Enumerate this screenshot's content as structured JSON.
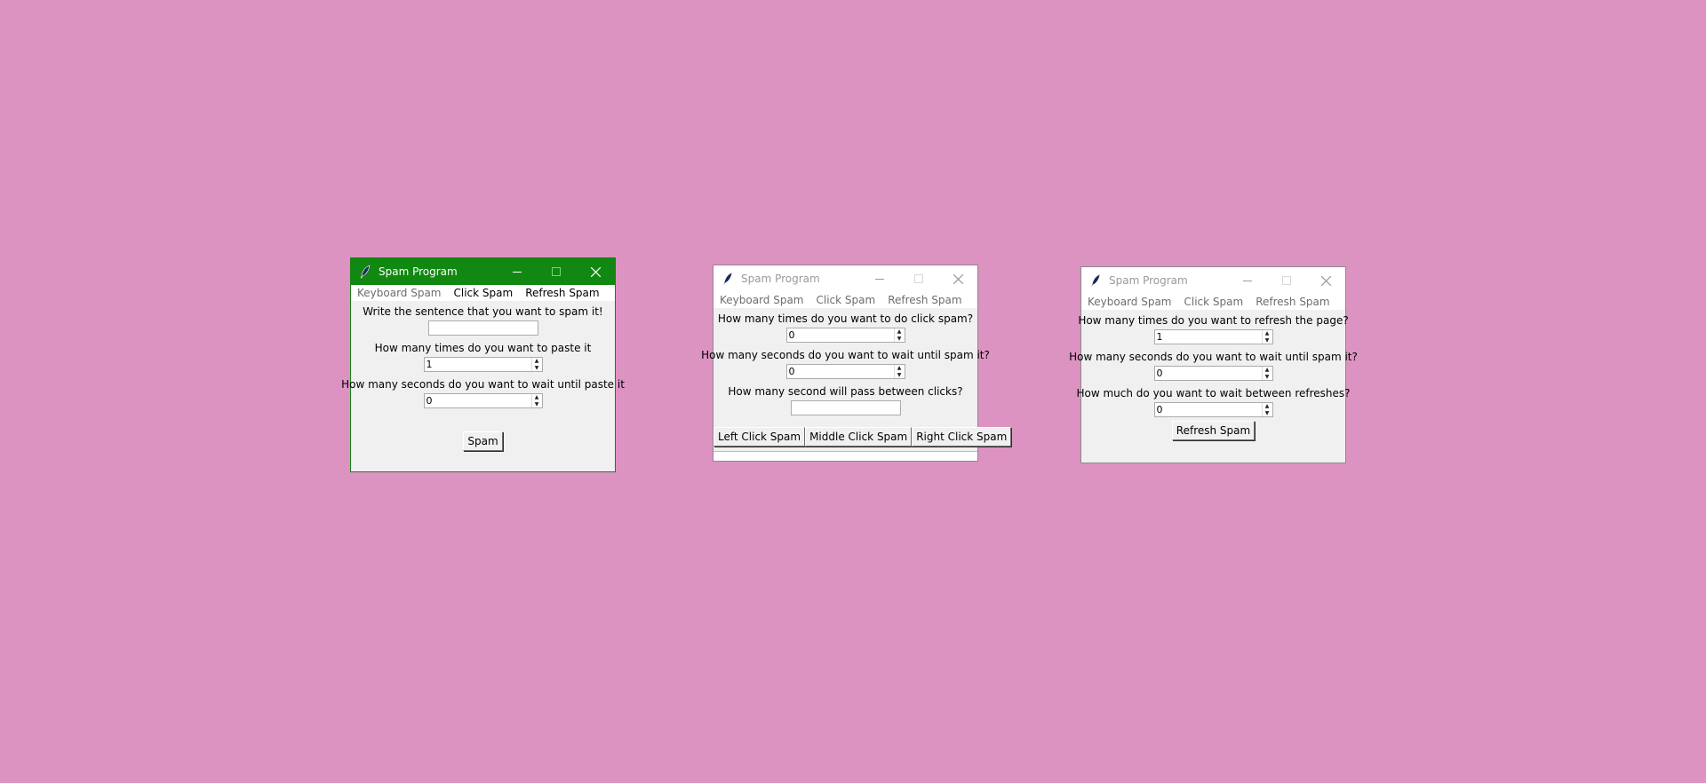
{
  "window1": {
    "title": "Spam Program",
    "menu": [
      "Keyboard Spam",
      "Click Spam",
      "Refresh Spam"
    ],
    "sentence_label": "Write the sentence that you want to spam it!",
    "sentence_value": "",
    "times_label": "How many times do you want to paste it",
    "times_value": "1",
    "seconds_label": "How many seconds do you want to wait until paste it",
    "seconds_value": "0",
    "spam_button": "Spam"
  },
  "window2": {
    "title": "Spam Program",
    "menu": [
      "Keyboard Spam",
      "Click Spam",
      "Refresh Spam"
    ],
    "times_label": "How many times do you want to do click spam?",
    "times_value": "0",
    "seconds_label": "How many seconds do you want to wait until spam it?",
    "seconds_value": "0",
    "between_label": "How many second will pass between clicks?",
    "between_value": "",
    "left_button": "Left Click Spam",
    "middle_button": "Middle Click Spam",
    "right_button": "Right Click Spam"
  },
  "window3": {
    "title": "Spam Program",
    "menu": [
      "Keyboard Spam",
      "Click Spam",
      "Refresh Spam"
    ],
    "times_label": "How many times do you want to refresh the page?",
    "times_value": "1",
    "seconds_label": "How many seconds do you want to wait until spam it?",
    "seconds_value": "0",
    "between_label": "How much do you want to wait between refreshes?",
    "between_value": "0",
    "refresh_button": "Refresh Spam"
  },
  "colors": {
    "desktop": "#dc93c2",
    "active_titlebar": "#118811",
    "window_bg": "#f0f0f0"
  }
}
